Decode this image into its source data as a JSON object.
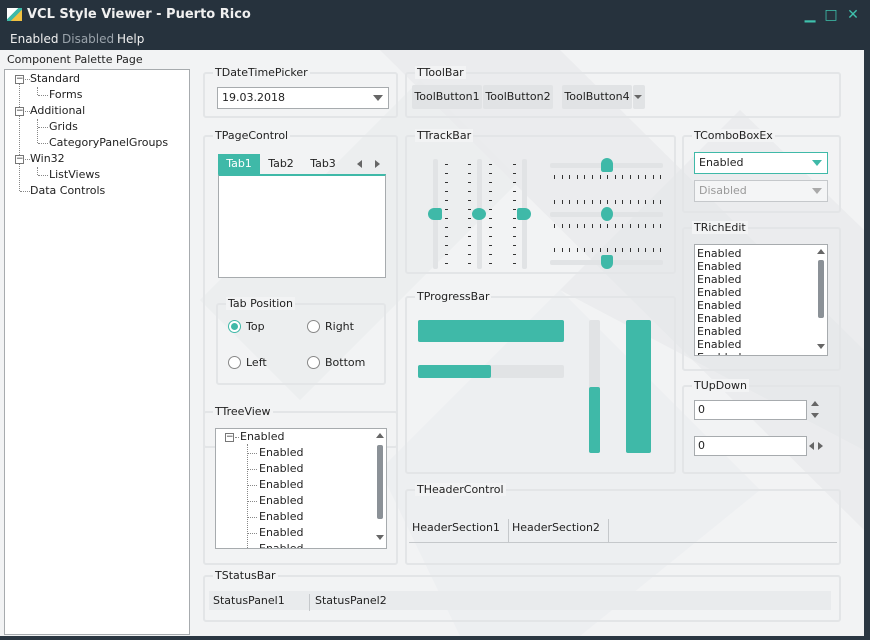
{
  "window": {
    "title": "VCL Style Viewer - Puerto Rico",
    "minimize": "▁",
    "maximize": "□",
    "close": "✕"
  },
  "menu": [
    "Enabled",
    "Disabled",
    "Help"
  ],
  "palette_label": "Component Palette Page",
  "nav_tree": [
    {
      "label": "Standard",
      "level": 0,
      "expander": "−"
    },
    {
      "label": "Forms",
      "level": 1
    },
    {
      "label": "Additional",
      "level": 0,
      "expander": "−"
    },
    {
      "label": "Grids",
      "level": 1
    },
    {
      "label": "CategoryPanelGroups",
      "level": 1
    },
    {
      "label": "Win32",
      "level": 0,
      "expander": "−"
    },
    {
      "label": "ListViews",
      "level": 1
    },
    {
      "label": "Data Controls",
      "level": 0
    }
  ],
  "datetimepicker": {
    "title": "TDateTimePicker",
    "value": "19.03.2018"
  },
  "toolbar": {
    "title": "TToolBar",
    "buttons": [
      "ToolButton1",
      "ToolButton2",
      "ToolButton4"
    ]
  },
  "trackbar": {
    "title": "TTrackBar",
    "positions": {
      "v1": 0.5,
      "v2": 0.5,
      "v3": 0.5,
      "h1": 0.5,
      "h2": 0.5,
      "h3": 0.5
    }
  },
  "comboboxex": {
    "title": "TComboBoxEx",
    "enabled_value": "Enabled",
    "disabled_value": "Disabled"
  },
  "pagecontrol": {
    "title": "TPageControl",
    "tabs": [
      "Tab1",
      "Tab2",
      "Tab3"
    ],
    "active": 0
  },
  "tabposition": {
    "title": "Tab Position",
    "options": [
      "Top",
      "Right",
      "Left",
      "Bottom"
    ],
    "selected": "Top"
  },
  "richedit": {
    "title": "TRichEdit",
    "lines": [
      "Enabled",
      "Enabled",
      "Enabled",
      "Enabled",
      "Enabled",
      "Enabled",
      "Enabled",
      "Enabled",
      "Enabled"
    ]
  },
  "progressbar": {
    "title": "TProgressBar",
    "h1": 1.0,
    "h2": 0.5,
    "v1": 0.5,
    "v2": 1.0
  },
  "updown": {
    "title": "TUpDown",
    "value1": "0",
    "value2": "0"
  },
  "treeview": {
    "title": "TTreeView",
    "root": "Enabled",
    "root_expander": "−",
    "children": [
      "Enabled",
      "Enabled",
      "Enabled",
      "Enabled",
      "Enabled",
      "Enabled",
      "Enabled"
    ]
  },
  "headercontrol": {
    "title": "THeaderControl",
    "sections": [
      "HeaderSection1",
      "HeaderSection2"
    ]
  },
  "statusbar": {
    "title": "TStatusBar",
    "panels": [
      "StatusPanel1",
      "StatusPanel2"
    ]
  },
  "colors": {
    "accent": "#3fb9a8",
    "titlebar": "#26323d",
    "client": "#f2f3f4"
  }
}
